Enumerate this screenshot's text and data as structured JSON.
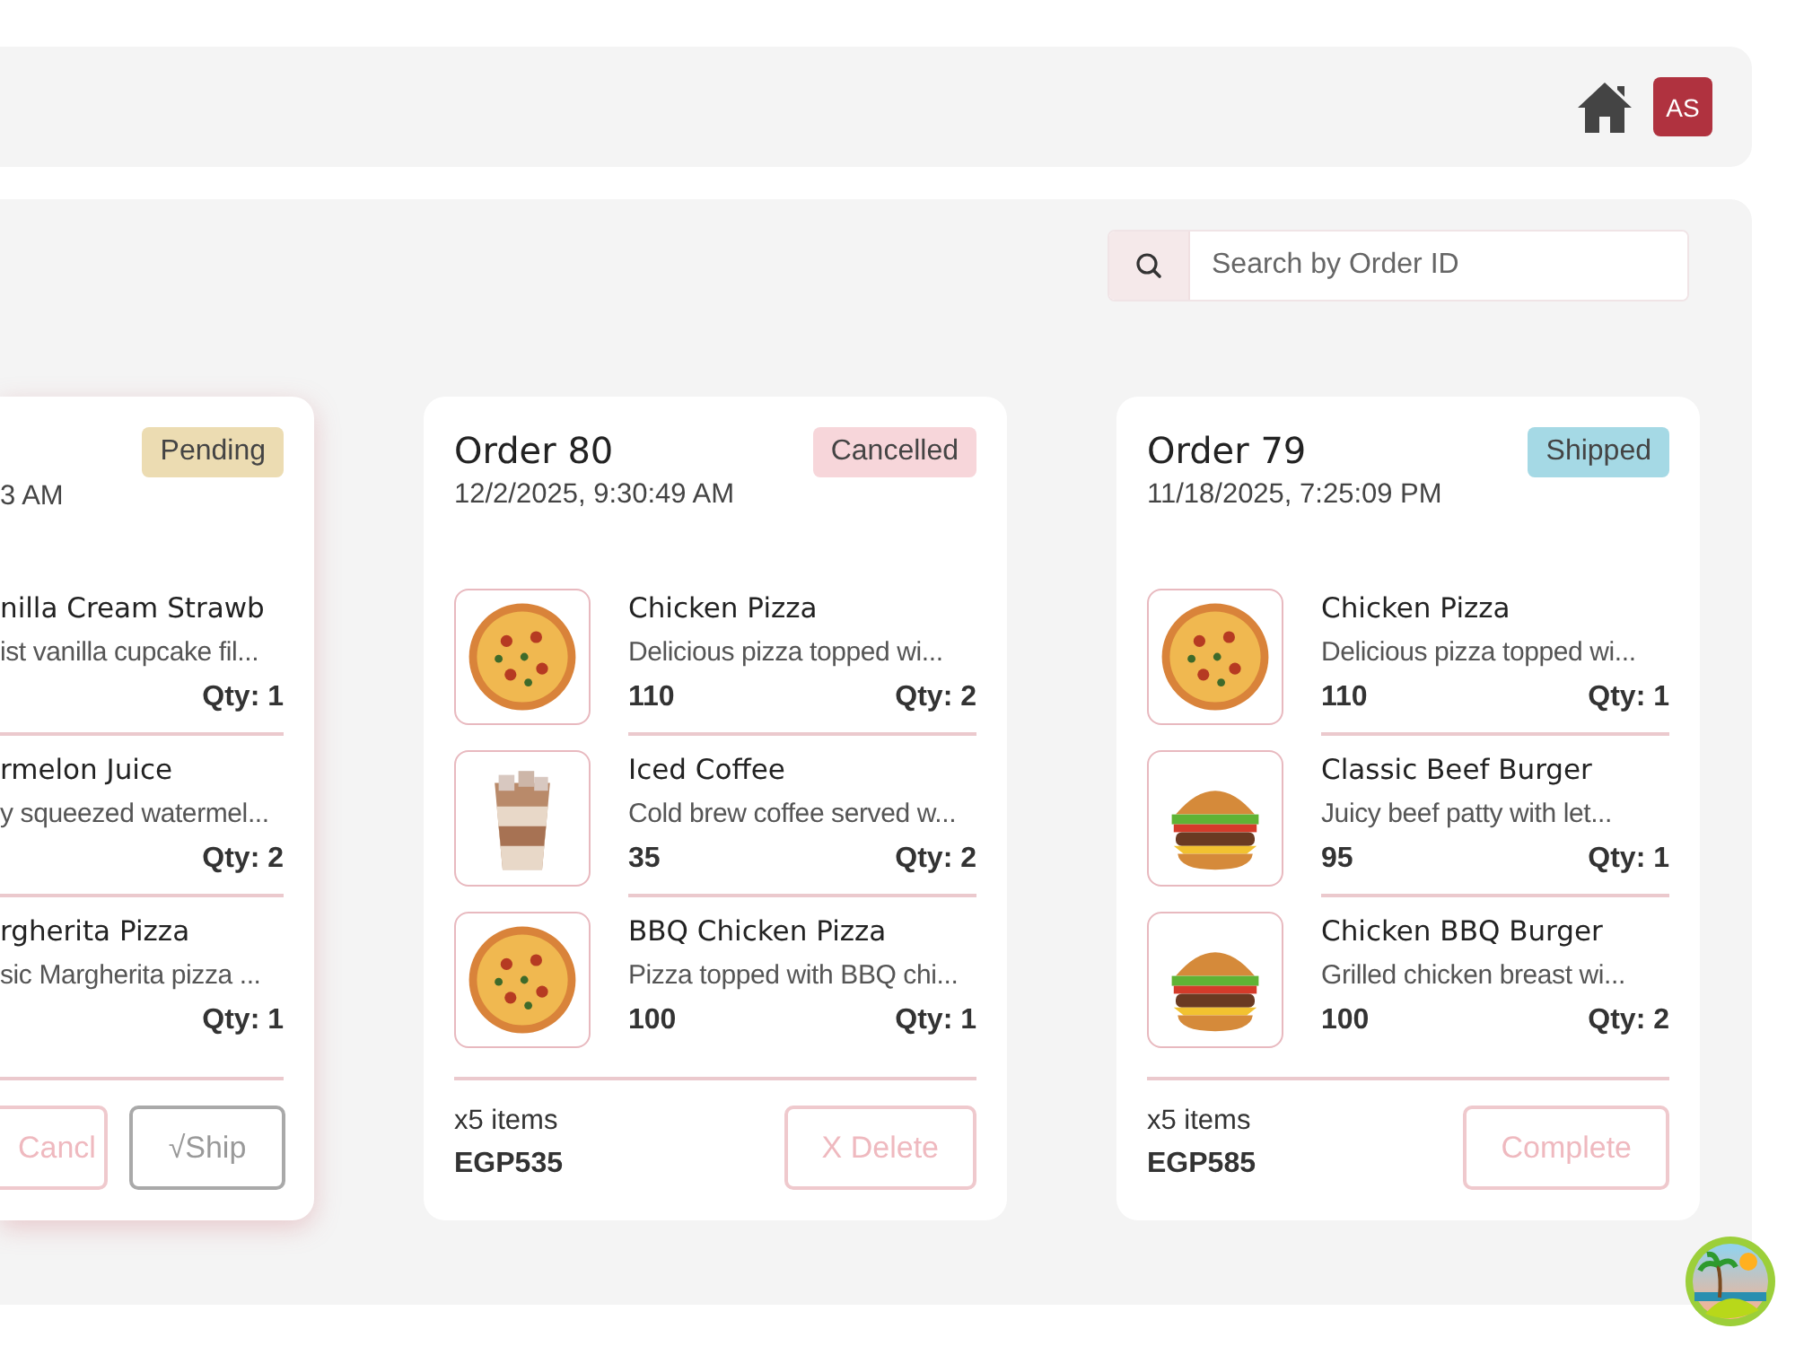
{
  "header": {
    "avatar": "AS"
  },
  "search": {
    "placeholder": "Search by Order ID"
  },
  "orders": [
    {
      "date": "3 AM",
      "status": {
        "label": "Pending",
        "color": "#ecdcb2"
      },
      "cut": true,
      "items": [
        {
          "name": "nilla Cream Strawb",
          "description": "ist vanilla cupcake fil...",
          "qty": "Qty: 1"
        },
        {
          "name": "rmelon Juice",
          "description": "y squeezed watermel...",
          "qty": "Qty: 2"
        },
        {
          "name": "rgherita Pizza",
          "description": "sic Margherita pizza ...",
          "qty": "Qty: 1"
        }
      ],
      "buttons": [
        {
          "label": "Cancl",
          "kind": "danger"
        },
        {
          "label": "√Ship",
          "kind": "neutral"
        }
      ]
    },
    {
      "title": "Order 80",
      "date": "12/2/2025, 9:30:49 AM",
      "status": {
        "label": "Cancelled",
        "color": "#f7d6da"
      },
      "cut": false,
      "items": [
        {
          "name": "Chicken Pizza",
          "description": "Delicious pizza topped wi...",
          "price": "110",
          "qty": "Qty: 2"
        },
        {
          "name": "Iced Coffee",
          "description": "Cold brew coffee served w...",
          "price": "35",
          "qty": "Qty: 2"
        },
        {
          "name": "BBQ Chicken Pizza",
          "description": "Pizza topped with BBQ chi...",
          "price": "100",
          "qty": "Qty: 1"
        }
      ],
      "count": "x5 items",
      "total": "EGP535",
      "buttons": [
        {
          "label": "X Delete",
          "kind": "danger"
        }
      ]
    },
    {
      "title": "Order 79",
      "date": "11/18/2025, 7:25:09 PM",
      "status": {
        "label": "Shipped",
        "color": "#a5d9e5"
      },
      "cut": false,
      "items": [
        {
          "name": "Chicken Pizza",
          "description": "Delicious pizza topped wi...",
          "price": "110",
          "qty": "Qty: 1"
        },
        {
          "name": "Classic Beef Burger",
          "description": "Juicy beef patty with let...",
          "price": "95",
          "qty": "Qty: 1"
        },
        {
          "name": "Chicken BBQ Burger",
          "description": "Grilled chicken breast wi...",
          "price": "100",
          "qty": "Qty: 2"
        }
      ],
      "count": "x5 items",
      "total": "EGP585",
      "buttons": [
        {
          "label": "Complete",
          "kind": "danger"
        }
      ]
    }
  ]
}
